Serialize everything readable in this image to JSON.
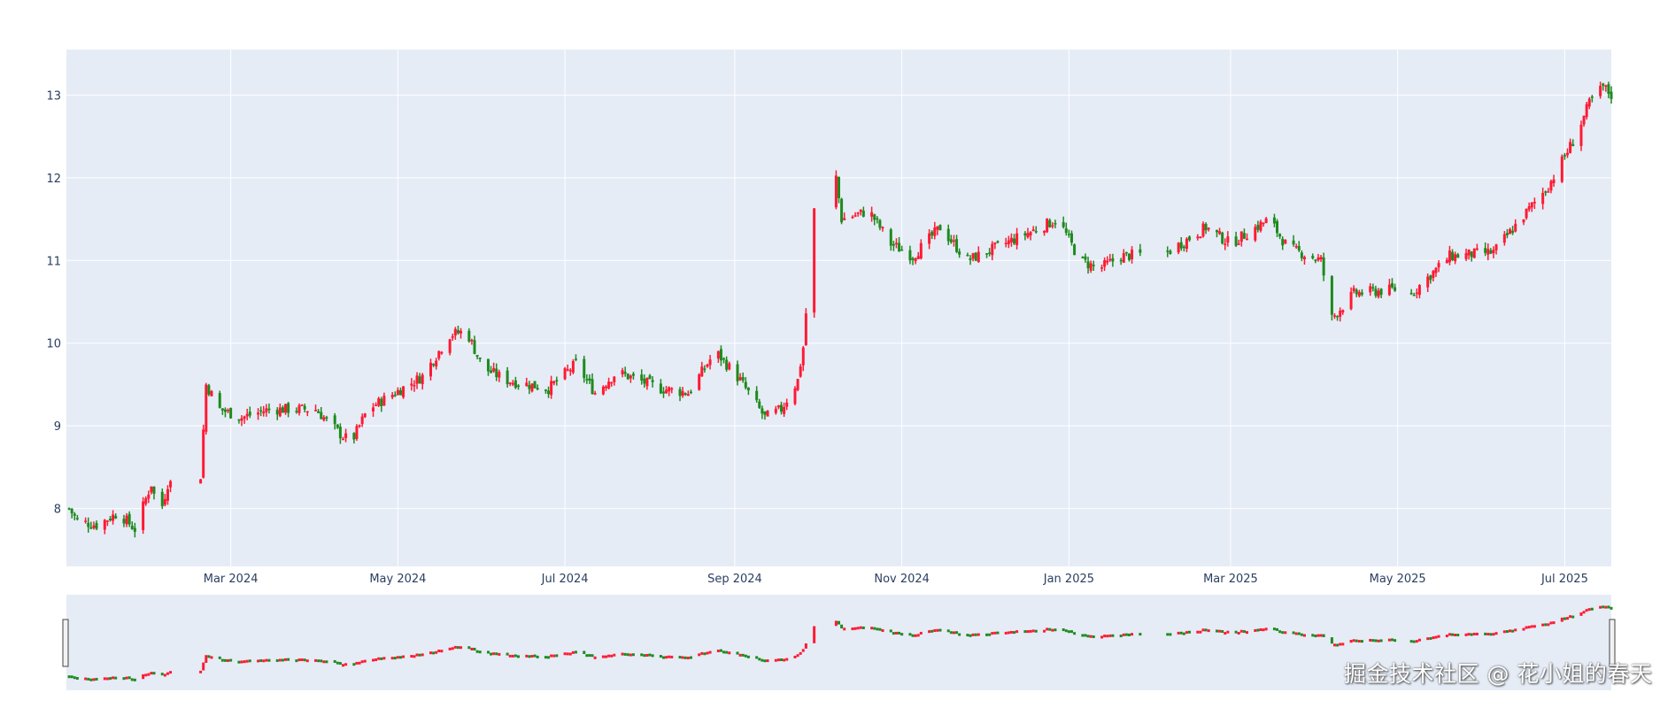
{
  "watermark": "掘金技术社区 @ 花小姐的春天",
  "chart_data": {
    "type": "candlestick",
    "x_range": [
      "2024-01-01",
      "2025-07-18"
    ],
    "ylim": [
      7.3,
      13.55
    ],
    "y_ticks": [
      8,
      9,
      10,
      11,
      12,
      13
    ],
    "x_ticks": [
      {
        "date": "2024-03-01",
        "label": "Mar 2024"
      },
      {
        "date": "2024-05-01",
        "label": "May 2024"
      },
      {
        "date": "2024-07-01",
        "label": "Jul 2024"
      },
      {
        "date": "2024-09-01",
        "label": "Sep 2024"
      },
      {
        "date": "2024-11-01",
        "label": "Nov 2024"
      },
      {
        "date": "2025-01-01",
        "label": "Jan 2025"
      },
      {
        "date": "2025-03-01",
        "label": "Mar 2025"
      },
      {
        "date": "2025-05-01",
        "label": "May 2025"
      },
      {
        "date": "2025-07-01",
        "label": "Jul 2025"
      }
    ],
    "colors": {
      "increasing": "#ff1a33",
      "decreasing": "#1e8a1e",
      "plot_bg": "#e5ecf6",
      "grid": "#ffffff",
      "tick_text": "#2a3f5f"
    },
    "grid": true,
    "rangeslider": true,
    "close_anchors": [
      [
        "2024-01-02",
        8.0
      ],
      [
        "2024-01-05",
        7.85
      ],
      [
        "2024-01-12",
        7.8
      ],
      [
        "2024-01-20",
        7.95
      ],
      [
        "2024-01-26",
        7.75
      ],
      [
        "2024-02-01",
        8.3
      ],
      [
        "2024-02-04",
        7.9
      ],
      [
        "2024-02-07",
        8.3
      ],
      [
        "2024-02-19",
        8.4
      ],
      [
        "2024-02-21",
        9.5
      ],
      [
        "2024-02-26",
        9.2
      ],
      [
        "2024-03-05",
        9.1
      ],
      [
        "2024-03-15",
        9.2
      ],
      [
        "2024-04-01",
        9.2
      ],
      [
        "2024-04-10",
        8.9
      ],
      [
        "2024-04-14",
        8.8
      ],
      [
        "2024-04-20",
        9.2
      ],
      [
        "2024-04-30",
        9.4
      ],
      [
        "2024-05-10",
        9.6
      ],
      [
        "2024-05-20",
        10.1
      ],
      [
        "2024-05-26",
        10.15
      ],
      [
        "2024-06-01",
        9.7
      ],
      [
        "2024-06-10",
        9.55
      ],
      [
        "2024-06-25",
        9.45
      ],
      [
        "2024-07-05",
        9.75
      ],
      [
        "2024-07-12",
        9.4
      ],
      [
        "2024-07-20",
        9.65
      ],
      [
        "2024-08-05",
        9.45
      ],
      [
        "2024-08-15",
        9.4
      ],
      [
        "2024-08-25",
        9.9
      ],
      [
        "2024-09-03",
        9.55
      ],
      [
        "2024-09-12",
        9.1
      ],
      [
        "2024-09-18",
        9.2
      ],
      [
        "2024-09-24",
        9.55
      ],
      [
        "2024-09-26",
        9.95
      ],
      [
        "2024-09-30",
        11.6
      ],
      [
        "2024-10-08",
        12.0
      ],
      [
        "2024-10-10",
        11.5
      ],
      [
        "2024-10-20",
        11.6
      ],
      [
        "2024-10-28",
        11.2
      ],
      [
        "2024-11-05",
        11.05
      ],
      [
        "2024-11-15",
        11.4
      ],
      [
        "2024-11-25",
        11.0
      ],
      [
        "2024-12-05",
        11.15
      ],
      [
        "2024-12-15",
        11.3
      ],
      [
        "2024-12-28",
        11.5
      ],
      [
        "2025-01-05",
        11.0
      ],
      [
        "2025-01-12",
        10.9
      ],
      [
        "2025-01-20",
        11.05
      ],
      [
        "2025-02-06",
        11.1
      ],
      [
        "2025-02-20",
        11.4
      ],
      [
        "2025-03-01",
        11.2
      ],
      [
        "2025-03-15",
        11.5
      ],
      [
        "2025-03-22",
        11.15
      ],
      [
        "2025-04-03",
        11.0
      ],
      [
        "2025-04-07",
        10.3
      ],
      [
        "2025-04-15",
        10.6
      ],
      [
        "2025-04-30",
        10.65
      ],
      [
        "2025-05-06",
        10.6
      ],
      [
        "2025-05-20",
        11.05
      ],
      [
        "2025-06-05",
        11.1
      ],
      [
        "2025-06-15",
        11.5
      ],
      [
        "2025-06-25",
        11.9
      ],
      [
        "2025-07-05",
        12.5
      ],
      [
        "2025-07-10",
        12.9
      ],
      [
        "2025-07-15",
        13.1
      ],
      [
        "2025-07-18",
        13.0
      ]
    ],
    "gaps": [
      [
        "2024-02-09",
        "2024-02-18"
      ],
      [
        "2024-10-01",
        "2024-10-07"
      ],
      [
        "2025-01-28",
        "2025-02-05"
      ],
      [
        "2025-05-01",
        "2025-05-05"
      ]
    ]
  }
}
